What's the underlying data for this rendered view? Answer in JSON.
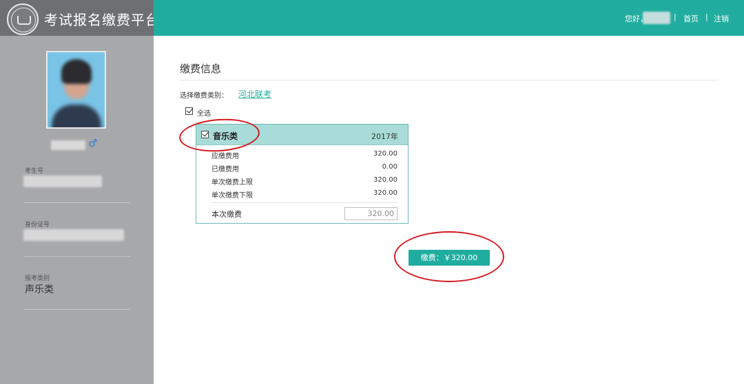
{
  "header": {
    "app_title": "考试报名缴费平台",
    "greeting": "您好，",
    "sep1": "|",
    "home_link": "首页",
    "sep2": "|",
    "logout_link": "注销"
  },
  "sidebar": {
    "gender_symbol": "♂",
    "fields": [
      {
        "label": "考生号",
        "value": ""
      },
      {
        "label": "身份证号",
        "value": ""
      },
      {
        "label": "报考类别",
        "value": "声乐类"
      }
    ]
  },
  "main": {
    "title": "缴费信息",
    "category_label": "选择缴费类别：",
    "category_value": "河北联考",
    "select_all_label": "全选",
    "card": {
      "title": "音乐类",
      "year": "2017年",
      "rows": [
        {
          "label": "应缴费用",
          "value": "320.00"
        },
        {
          "label": "已缴费用",
          "value": "0.00"
        },
        {
          "label": "单次缴费上限",
          "value": "320.00"
        },
        {
          "label": "单次缴费下限",
          "value": "320.00"
        }
      ],
      "this_payment_label": "本次缴费",
      "this_payment_value": "320.00"
    },
    "pay_button": "缴费：￥320.00"
  },
  "colors": {
    "accent": "#20ada0",
    "sidebar_bg": "#a7a8aa",
    "annotation": "#d3191f"
  }
}
